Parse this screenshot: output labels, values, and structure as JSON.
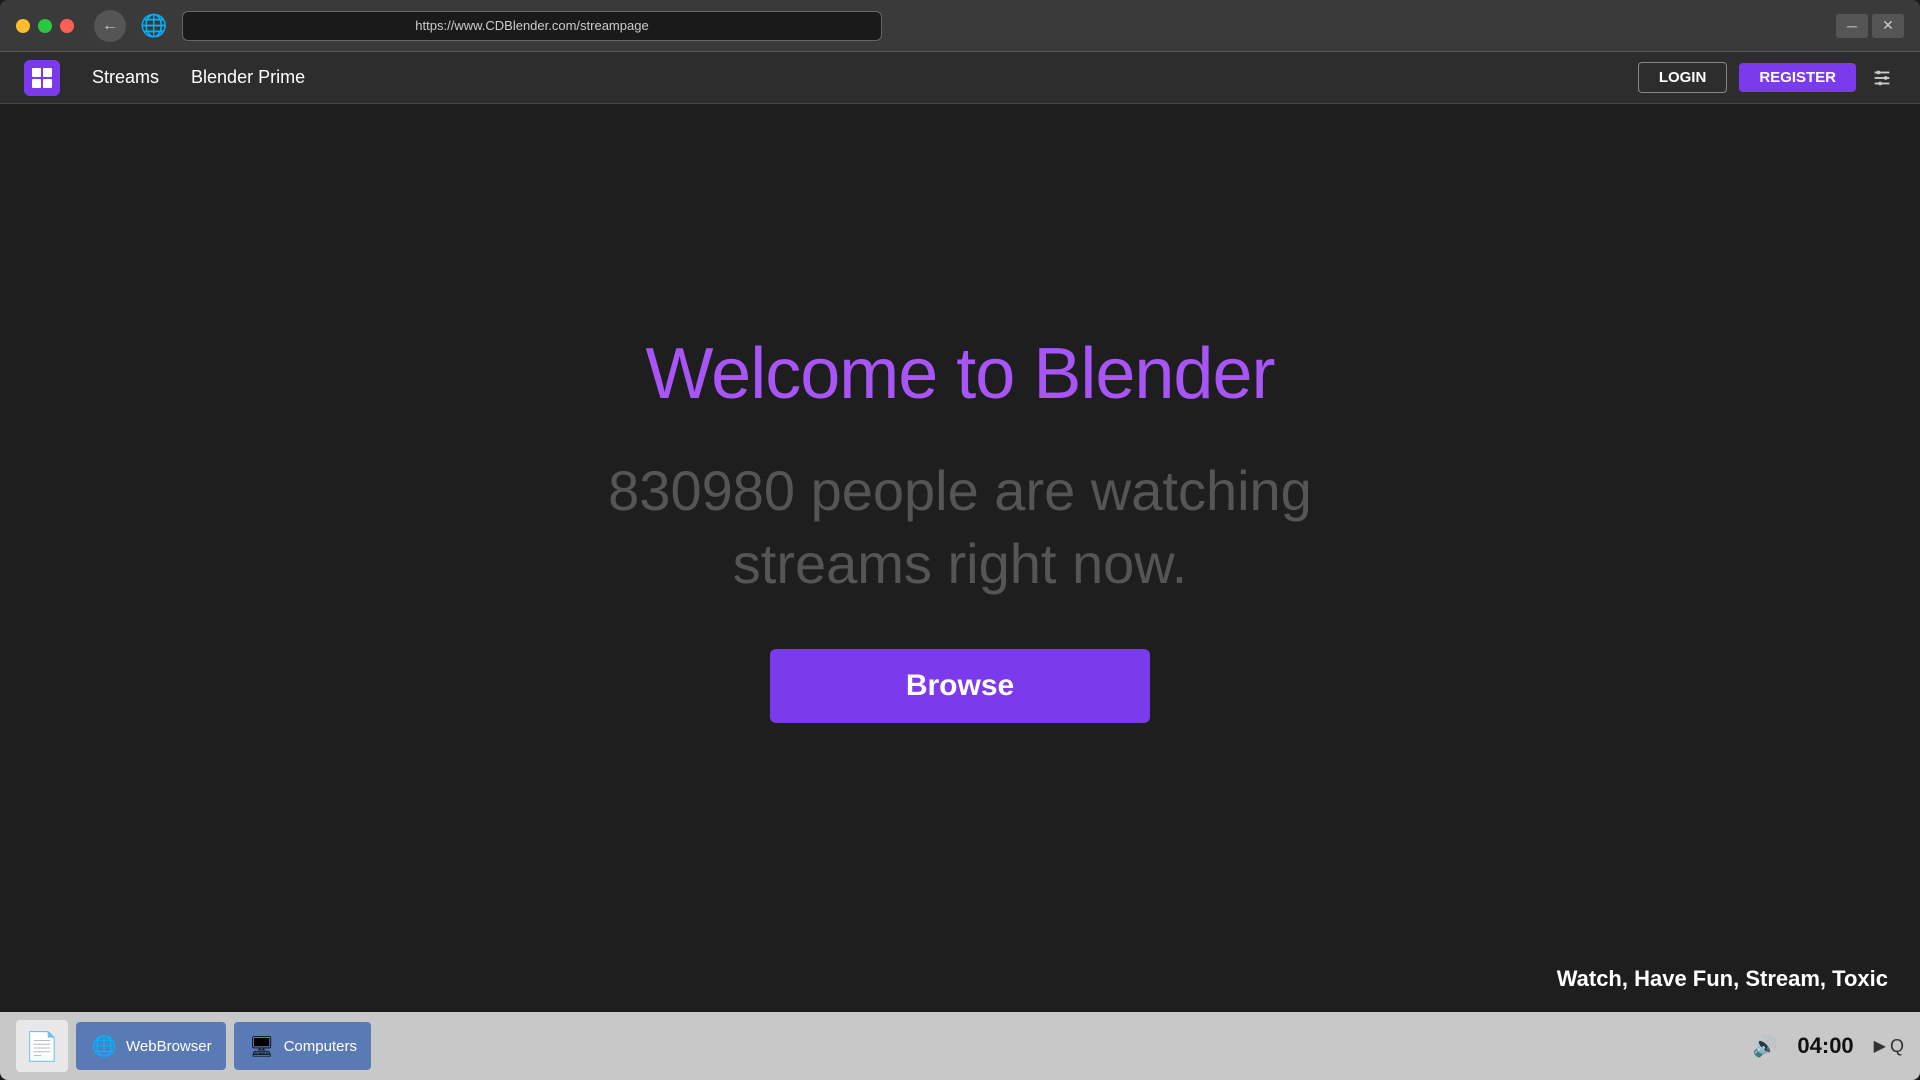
{
  "titlebar": {
    "url": "https://www.CDBlender.com/streampage",
    "back_arrow": "‹",
    "globe": "🌐"
  },
  "navbar": {
    "logo_alt": "Blender Logo",
    "streams_label": "Streams",
    "blender_prime_label": "Blender Prime",
    "login_label": "LOGIN",
    "register_label": "REGISTER",
    "settings_icon": "✂"
  },
  "main": {
    "welcome_title": "Welcome to Blender",
    "viewer_count": "830980 people are watching",
    "viewer_count_line2": "streams right now.",
    "browse_label": "Browse",
    "tagline": "Watch, Have Fun, Stream, Toxic"
  },
  "taskbar": {
    "webbrowser_label": "WebBrowser",
    "computers_label": "Computers",
    "time": "04:00",
    "volume_icon": "🔊",
    "search_icon": "Q"
  },
  "colors": {
    "purple": "#a855f7",
    "purple_dark": "#7c3aed",
    "dark_bg": "#1e1e1e",
    "nav_bg": "#2d2d2d"
  }
}
